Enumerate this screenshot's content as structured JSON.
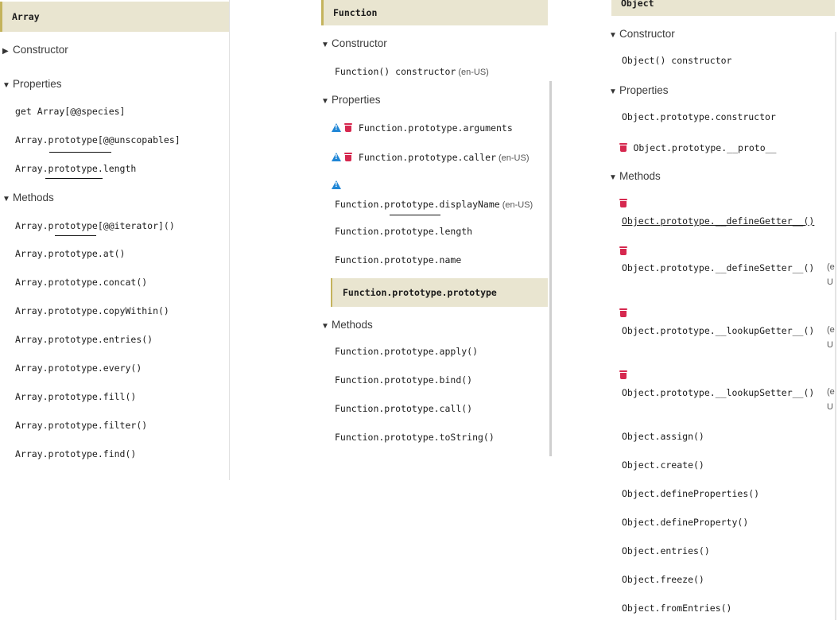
{
  "array_panel": {
    "title": "Array",
    "constructor_label": "Constructor",
    "properties_label": "Properties",
    "methods_label": "Methods",
    "properties": [
      "get Array[@@species]",
      "Array.prototype[@@unscopables]",
      "Array.prototype.length"
    ],
    "methods": [
      "Array.prototype[@@iterator]()",
      "Array.prototype.at()",
      "Array.prototype.concat()",
      "Array.prototype.copyWithin()",
      "Array.prototype.entries()",
      "Array.prototype.every()",
      "Array.prototype.fill()",
      "Array.prototype.filter()",
      "Array.prototype.find()"
    ]
  },
  "function_panel": {
    "title": "Function",
    "constructor_label": "Constructor",
    "constructor_item": "Function() constructor",
    "locale": "(en-US)",
    "properties_label": "Properties",
    "methods_label": "Methods",
    "properties": [
      "Function.prototype.arguments",
      "Function.prototype.caller",
      "Function.prototype.displayName",
      "Function.prototype.length",
      "Function.prototype.name"
    ],
    "active_item": "Function.prototype.prototype",
    "methods": [
      "Function.prototype.apply()",
      "Function.prototype.bind()",
      "Function.prototype.call()",
      "Function.prototype.toString()"
    ]
  },
  "object_panel": {
    "title": "Object",
    "constructor_label": "Constructor",
    "constructor_item": "Object() constructor",
    "properties_label": "Properties",
    "methods_label": "Methods",
    "properties": [
      "Object.prototype.constructor",
      "Object.prototype.__proto__"
    ],
    "deprecated_methods": [
      "Object.prototype.__defineGetter__()",
      "Object.prototype.__defineSetter__()",
      "Object.prototype.__lookupGetter__()",
      "Object.prototype.__lookupSetter__()"
    ],
    "locale_fragment_top": "(e",
    "locale_fragment_bottom": "U",
    "methods": [
      "Object.assign()",
      "Object.create()",
      "Object.defineProperties()",
      "Object.defineProperty()",
      "Object.entries()",
      "Object.freeze()",
      "Object.fromEntries()"
    ]
  },
  "icons": {
    "expanded": "▼",
    "collapsed": "▶",
    "warning": "warning-icon",
    "deprecated": "trash-icon"
  },
  "colors": {
    "active_bg": "#e9e5d0",
    "active_border": "#c4b35c",
    "warning": "#1f86d6",
    "deprecated": "#d6284f"
  }
}
